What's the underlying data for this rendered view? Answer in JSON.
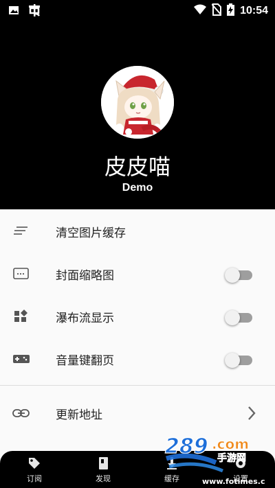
{
  "status_bar": {
    "time": "10:54",
    "left_icons": [
      "image-icon",
      "bug-icon"
    ],
    "right_icons": [
      "wifi-icon",
      "no-sim-icon",
      "battery-charging-icon"
    ]
  },
  "profile": {
    "name": "皮皮喵",
    "subtitle": "Demo",
    "avatar": "anime-cat-girl-avatar"
  },
  "settings": {
    "items": [
      {
        "label": "清空图片缓存",
        "icon": "clear-list-icon",
        "control": "none"
      },
      {
        "label": "封面缩略图",
        "icon": "thumbnail-icon",
        "control": "toggle",
        "value": false
      },
      {
        "label": "瀑布流显示",
        "icon": "dashboard-icon",
        "control": "toggle",
        "value": false
      },
      {
        "label": "音量键翻页",
        "icon": "gamepad-icon",
        "control": "toggle",
        "value": false
      },
      {
        "label": "更新地址",
        "icon": "link-icon",
        "control": "chevron"
      }
    ]
  },
  "bottom_nav": {
    "items": [
      {
        "label": "订阅",
        "icon": "tag-icon"
      },
      {
        "label": "发现",
        "icon": "book-icon"
      },
      {
        "label": "缓存",
        "icon": "download-icon"
      },
      {
        "label": "设置",
        "icon": "settings-icon"
      }
    ]
  },
  "watermark": {
    "brand": "289.com",
    "tagline": "手游网",
    "url": "www.fotimes.com"
  },
  "colors": {
    "header_bg": "#000000",
    "sheet_bg": "#fafafa",
    "toggle_track_off": "#9e9e9e",
    "toggle_knob_off": "#f1f1f1",
    "watermark_blue": "#1e6fd9",
    "watermark_orange": "#f08a1c"
  }
}
